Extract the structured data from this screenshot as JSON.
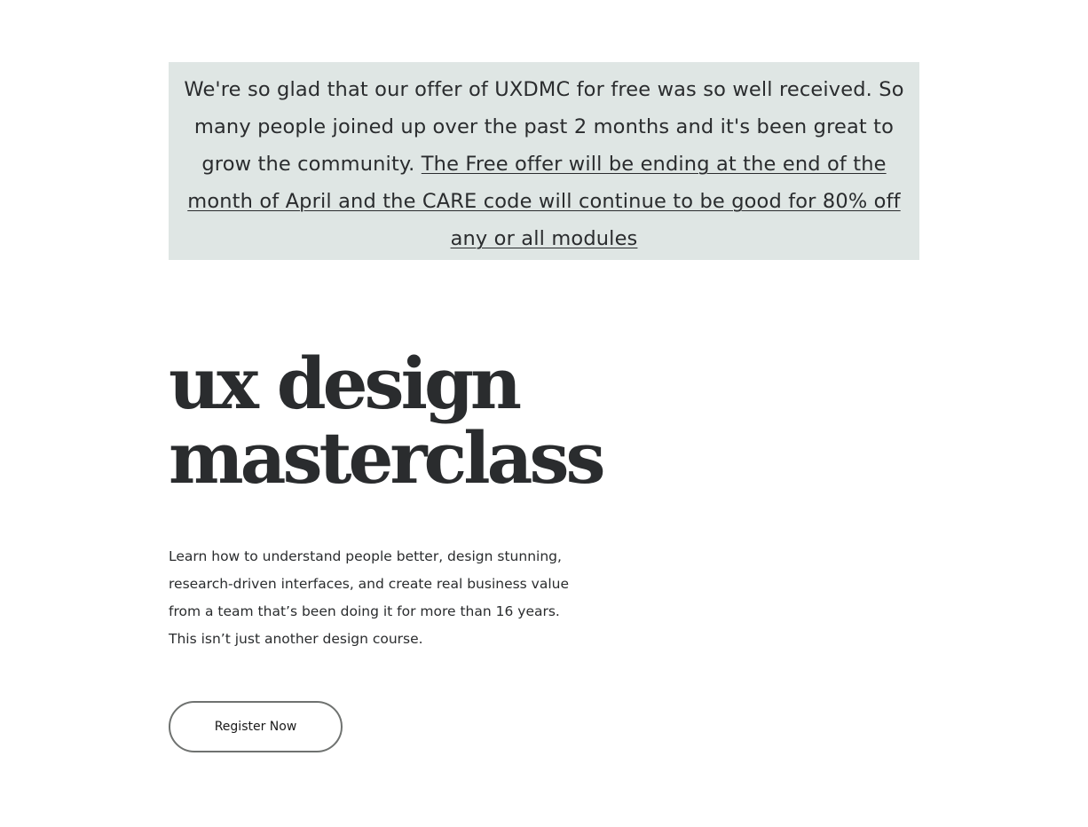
{
  "announcement": {
    "intro_text": "We're so glad that our offer of UXDMC for free was so well received. So many people joined up over the past 2 months and it's been great to grow the community. ",
    "link_text": "The Free offer will be ending at the end of the month of April and the CARE code will continue to be good for 80% off any or all modules",
    "background_color": "#dfe6e4"
  },
  "hero": {
    "title_line_1": "ux design",
    "title_line_2": "masterclass",
    "description_lines": [
      "Learn how to understand people better, design stunning,",
      "research-driven interfaces, and create real business value",
      "from a team that’s been doing it for more than 16 years.",
      "This isn’t just another design course."
    ],
    "register_label": "Register Now"
  },
  "colors": {
    "text": "#2a2c2e",
    "button_border": "#6f7270"
  }
}
